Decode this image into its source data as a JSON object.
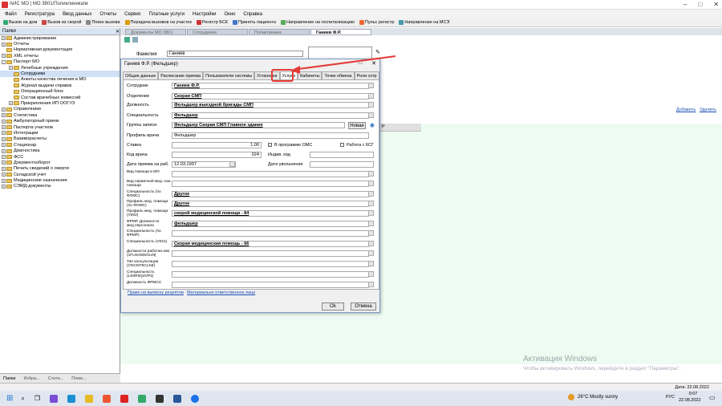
{
  "window": {
    "title": "АИС МО | МО 3801/Поликлиника/м"
  },
  "menu": [
    "Файл",
    "Регистратура",
    "Ввод данных",
    "Отчеты",
    "Сервис",
    "Платные услуги",
    "Настройки",
    "Окно",
    "Справка"
  ],
  "toolbar": [
    "Вызов на дом",
    "Вызов из скорой",
    "Поиск вызова",
    "Передача вызовов на участок",
    "Регистр БСК",
    "Принять пациента",
    "Направление на госпитализацию",
    "Пульс регистр",
    "Направление на МСЭ"
  ],
  "sidebar": {
    "header": "Папки",
    "items": [
      {
        "label": "Администрирование",
        "level": 0,
        "exp": "+"
      },
      {
        "label": "Отчеты",
        "level": 0,
        "exp": "+"
      },
      {
        "label": "Нормативная документация",
        "level": 0,
        "exp": ""
      },
      {
        "label": "XML отчеты",
        "level": 0,
        "exp": "+"
      },
      {
        "label": "Паспорт МО",
        "level": 0,
        "exp": "-"
      },
      {
        "label": "Лечебные учреждения",
        "level": 1,
        "exp": "+"
      },
      {
        "label": "Сотрудники",
        "level": 1,
        "exp": "",
        "selected": true
      },
      {
        "label": "Анкеты качества лечения в МО",
        "level": 1,
        "exp": ""
      },
      {
        "label": "Журнал выдачи справок",
        "level": 1,
        "exp": ""
      },
      {
        "label": "Операционный блок",
        "level": 1,
        "exp": ""
      },
      {
        "label": "Состав врачебных комиссий",
        "level": 1,
        "exp": ""
      },
      {
        "label": "Прикрепления ИП ООГУЗ",
        "level": 1,
        "exp": "+"
      },
      {
        "label": "Справочники",
        "level": 0,
        "exp": "+"
      },
      {
        "label": "Статистика",
        "level": 0,
        "exp": "+"
      },
      {
        "label": "Амбулаторный прием",
        "level": 0,
        "exp": "+"
      },
      {
        "label": "Паспорта участков",
        "level": 0,
        "exp": "+"
      },
      {
        "label": "Интеграции",
        "level": 0,
        "exp": "+"
      },
      {
        "label": "Взаиморасчеты",
        "level": 0,
        "exp": "+"
      },
      {
        "label": "Стационар",
        "level": 0,
        "exp": "+"
      },
      {
        "label": "Диагностика",
        "level": 0,
        "exp": "+"
      },
      {
        "label": "ФСС",
        "level": 0,
        "exp": "+"
      },
      {
        "label": "Документооборот",
        "level": 0,
        "exp": "+"
      },
      {
        "label": "Печать сведений о смерти",
        "level": 0,
        "exp": "+"
      },
      {
        "label": "Складской учет",
        "level": 0,
        "exp": "+"
      },
      {
        "label": "Медицинские назначения",
        "level": 0,
        "exp": "+"
      },
      {
        "label": "СЭМД-документы",
        "level": 0,
        "exp": "+"
      }
    ],
    "bottom_tabs": [
      "Папки",
      "Избра...",
      "Стати...",
      "Поме..."
    ]
  },
  "doc_tabs": [
    "Документы МО 3801",
    "Сотрудники",
    "Поликлиника",
    "Ганиев Ф.Р."
  ],
  "doc": {
    "surname_label": "Фамилия",
    "surname": "Ганиев",
    "add_link": "Добавить",
    "del_link": "Удалить",
    "col_hint": "Р"
  },
  "dialog": {
    "title": "Ганиев Ф.Р. (Фельдшер)",
    "tabs": [
      "Общие данные",
      "Расписание приема",
      "Пользователи системы",
      "Установки",
      "Услуги",
      "Кабинеты",
      "Точки обмена",
      "Роли сотр"
    ],
    "fields": [
      {
        "label": "Сотрудник",
        "value": "Ганиев Ф.Р."
      },
      {
        "label": "Отделение",
        "value": "Скорая СМП"
      },
      {
        "label": "Должность",
        "value": "Фельдшер выездной бригады СМП"
      },
      {
        "label": "Специальность",
        "value": "Фельдшер"
      },
      {
        "label": "Группы записи",
        "value": "Фельдшер Скорая СМП Главное здание"
      },
      {
        "label": "Профиль врача",
        "value": "Фельдшер"
      }
    ],
    "new_button": "Новая",
    "stavka_label": "Ставка",
    "stavka": "1.00",
    "oms_label": "В программе ОМС",
    "ksg_label": "Работа с КСГ",
    "code_label": "Код врача",
    "code": "024",
    "indiv_label": "Индив. код",
    "hire_label": "Дата приема на раб.",
    "hire": "12.03.1997",
    "fire_label": "Дата увольнения",
    "fields2": [
      {
        "label": "Вид помощи в МО",
        "value": ""
      },
      {
        "label": "Вид первичной мед.-сан. помощи",
        "value": ""
      },
      {
        "label": "Специальность (по ФОМС)",
        "value": "Другое"
      },
      {
        "label": "Профиль мед. помощи (по ФОМС)",
        "value": "Другое"
      },
      {
        "label": "Профиль мед. помощи (V002)",
        "value": "скорой медицинской помощи - 84"
      },
      {
        "label": "ФРМР. Должности мед.персонала",
        "value": "фельдшер"
      },
      {
        "label": "Специальность (по ФРМР)",
        "value": ""
      },
      {
        "label": "Специальность (V021)",
        "value": "Скорая медицинская помощь - 66"
      },
      {
        "label": "Должности работни-ков (1FUSAMSGUN)",
        "value": ""
      },
      {
        "label": "Тип консультации (CNCM76CLKE)",
        "value": ""
      },
      {
        "label": "Специальность (LS0R0Q4VP4)",
        "value": ""
      },
      {
        "label": "Должность ФРМСС",
        "value": ""
      }
    ],
    "link1": "Право на выписку рецептов",
    "link2": "Материально ответственное лицо",
    "ok": "Ok",
    "cancel": "Отмена"
  },
  "activation": {
    "line1": "Активация Windows",
    "line2": "Чтобы активировать Windows, перейдите в раздел \"Параметры\"."
  },
  "status": {
    "date": "Дата: 22.08.2022"
  },
  "taskbar": {
    "weather": "26°C  Mostly sunny",
    "lang": "РУС",
    "time": "9:07",
    "date": "22.08.2022"
  }
}
